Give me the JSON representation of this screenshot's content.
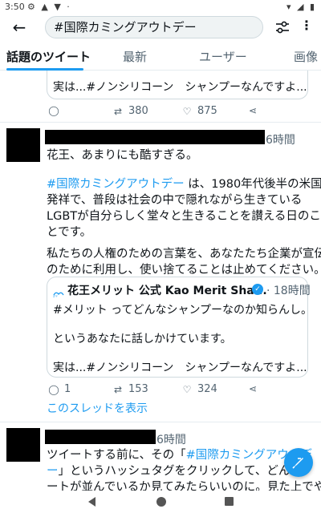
{
  "status_bar": {
    "time": "3:50",
    "left_icons": "⚙ ▲ ▼ ·",
    "right_icons": "▾ ◢ ▮"
  },
  "search": {
    "query": "#国際カミングアウトデー"
  },
  "tabs": [
    {
      "label": "話題のツイート"
    },
    {
      "label": "最新"
    },
    {
      "label": "ユーザー"
    },
    {
      "label": "画像"
    }
  ],
  "top_quote": {
    "text": "実は...#ノンシリコーン　シャンプーなんですよ..."
  },
  "top_actions": {
    "retweets": "380",
    "likes": "875"
  },
  "tweet1": {
    "time": "6時間",
    "line1": "花王、あまりにも酷すぎる。",
    "hashtag": "#国際カミングアウトデー",
    "line2_rest": " は、1980年代後半の米国",
    "line3": "発祥で、普段は社会の中で隠れながら生きている",
    "line4": "LGBTが自分らしく堂々と生きることを讃える日のこ",
    "line5": "とです。",
    "line6": "私たちの人権のための言葉を、あなたたち企業が宣伝",
    "line7": "のために利用し、使い捨てることは止めてください。",
    "quote": {
      "logo": "花王",
      "name": "花王メリット 公式 Kao Merit Sha...",
      "time": "· 18時間",
      "line1": "#メリット ってどんなシャンプーなのか知らんし。",
      "line2": "というあなたに話しかけています。",
      "line3": "実は...#ノンシリコーン　シャンプーなんですよ..."
    },
    "replies": "1",
    "retweets": "153",
    "likes": "324",
    "thread_link": "このスレッドを表示"
  },
  "tweet2": {
    "time": "6時間",
    "line1_a": "ツイートする前に、その「",
    "line1_hash": "#国際カミングアウトデ",
    "line2_hash": "ー",
    "line2_rest": "」というハッシュタグをクリックして、どんな",
    "line3": "ートが並んでいるか見てみたらいいのに。見た上でや"
  },
  "colors": {
    "accent": "#1d9bf0",
    "text": "#0f1419",
    "muted": "#536471"
  },
  "icons": [
    "back-arrow-icon",
    "filter-icon",
    "more-vert-icon",
    "reply-icon",
    "retweet-icon",
    "like-icon",
    "share-icon",
    "verified-icon",
    "compose-icon"
  ]
}
